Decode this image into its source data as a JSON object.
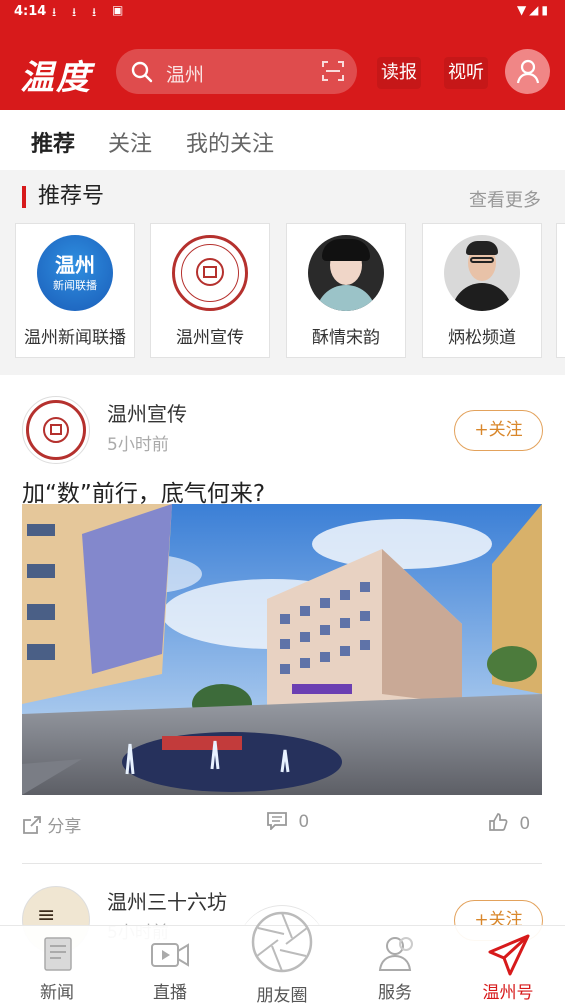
{
  "status": {
    "time": "4:14"
  },
  "header": {
    "logo": "温度",
    "search_placeholder": "温州",
    "read_paper": "读报",
    "audio_video": "视听"
  },
  "tabs": [
    {
      "label": "推荐"
    },
    {
      "label": "关注"
    },
    {
      "label": "我的关注"
    }
  ],
  "recommend": {
    "title": "推荐号",
    "more": "查看更多",
    "items": [
      {
        "name": "温州新闻联播",
        "logo_text_top": "温州",
        "logo_text_bottom": "新闻联播"
      },
      {
        "name": "温州宣传"
      },
      {
        "name": "酥情宋韵"
      },
      {
        "name": "炳松频道"
      }
    ]
  },
  "post": {
    "author": "温州宣传",
    "time": "5小时前",
    "follow": "+关注",
    "headline": "加“数”前行，底气何来?",
    "share": "分享",
    "comments": "0",
    "likes": "0"
  },
  "next_post": {
    "author": "温州三十六坊",
    "time": "5小时前",
    "follow": "+关注"
  },
  "bottom_nav": [
    {
      "label": "新闻"
    },
    {
      "label": "直播"
    },
    {
      "label": "朋友圈"
    },
    {
      "label": "服务"
    },
    {
      "label": "温州号"
    }
  ],
  "colors": {
    "brand": "#d71a1b",
    "follow": "#d9872b"
  }
}
